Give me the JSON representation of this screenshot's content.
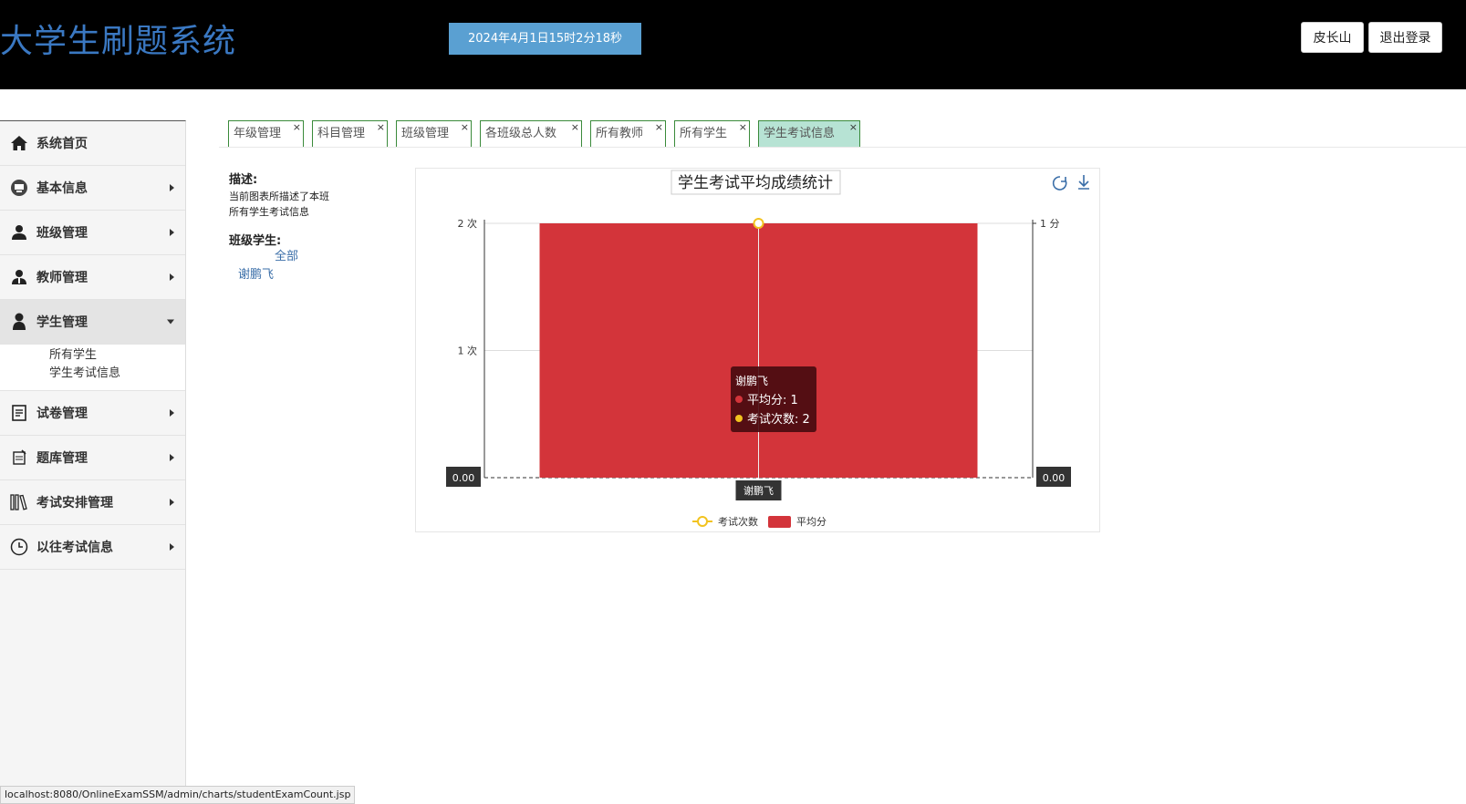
{
  "header": {
    "app_title": "大学生刷题系统",
    "datetime": "2024年4月1日15时2分18秒",
    "user_button": "皮长山",
    "logout_button": "退出登录"
  },
  "sidebar": {
    "items": [
      {
        "label": "系统首页",
        "icon": "home-icon",
        "has_caret": false
      },
      {
        "label": "基本信息",
        "icon": "info-icon",
        "has_caret": true
      },
      {
        "label": "班级管理",
        "icon": "user-group-icon",
        "has_caret": true
      },
      {
        "label": "教师管理",
        "icon": "teacher-icon",
        "has_caret": true
      },
      {
        "label": "学生管理",
        "icon": "student-icon",
        "has_caret": true,
        "expanded": true
      },
      {
        "label": "试卷管理",
        "icon": "paper-icon",
        "has_caret": true
      },
      {
        "label": "题库管理",
        "icon": "question-bank-icon",
        "has_caret": true
      },
      {
        "label": "考试安排管理",
        "icon": "books-icon",
        "has_caret": true
      },
      {
        "label": "以往考试信息",
        "icon": "clock-icon",
        "has_caret": true
      }
    ],
    "student_submenu": [
      "所有学生",
      "学生考试信息"
    ]
  },
  "tabs": [
    {
      "label": "年级管理",
      "close": "×"
    },
    {
      "label": "科目管理",
      "close": "×"
    },
    {
      "label": "班级管理",
      "close": "×"
    },
    {
      "label": "各班级总人数",
      "close": "×"
    },
    {
      "label": "所有教师",
      "close": "×"
    },
    {
      "label": "所有学生",
      "close": "×"
    },
    {
      "label": "学生考试信息",
      "close": "×",
      "active": true
    }
  ],
  "description": {
    "title": "描述:",
    "text": "当前图表所描述了本班 所有学生考试信息",
    "class_students_title": "班级学生:",
    "all_link": "全部",
    "students": [
      "谢鹏飞"
    ]
  },
  "chart_data": {
    "type": "bar",
    "title": "学生考试平均成绩统计",
    "categories": [
      "谢鹏飞"
    ],
    "series": [
      {
        "name": "平均分",
        "type": "bar",
        "values": [
          1
        ],
        "color": "#d3343a",
        "axis": "right",
        "unit": "分"
      },
      {
        "name": "考试次数",
        "type": "line",
        "values": [
          2
        ],
        "color": "#f2c31f",
        "axis": "left",
        "unit": "次"
      }
    ],
    "y_left": {
      "ticks": [
        "1 次",
        "2 次"
      ],
      "range": [
        0,
        2
      ]
    },
    "y_right": {
      "ticks": [
        "1 分"
      ],
      "range": [
        0,
        1
      ]
    },
    "axis_pointer_labels": {
      "left": "0.00",
      "right": "0.00",
      "x": "谢鹏飞"
    },
    "tooltip": {
      "title": "谢鹏飞",
      "lines": [
        "平均分: 1",
        "考试次数: 2"
      ]
    },
    "legend": [
      "考试次数",
      "平均分"
    ],
    "legend_position": "bottom-center",
    "toolbox": [
      "refresh-icon",
      "download-icon"
    ]
  },
  "status_bar": {
    "url": "localhost:8080/OnlineExamSSM/admin/charts/studentExamCount.jsp"
  },
  "colors": {
    "header_bg": "#000000",
    "title_blue": "#3a78c2",
    "datetime_bg": "#5aa0d2",
    "bar_red": "#d3343a",
    "line_yellow": "#f2c31f",
    "active_tab": "#b7e3d4"
  }
}
